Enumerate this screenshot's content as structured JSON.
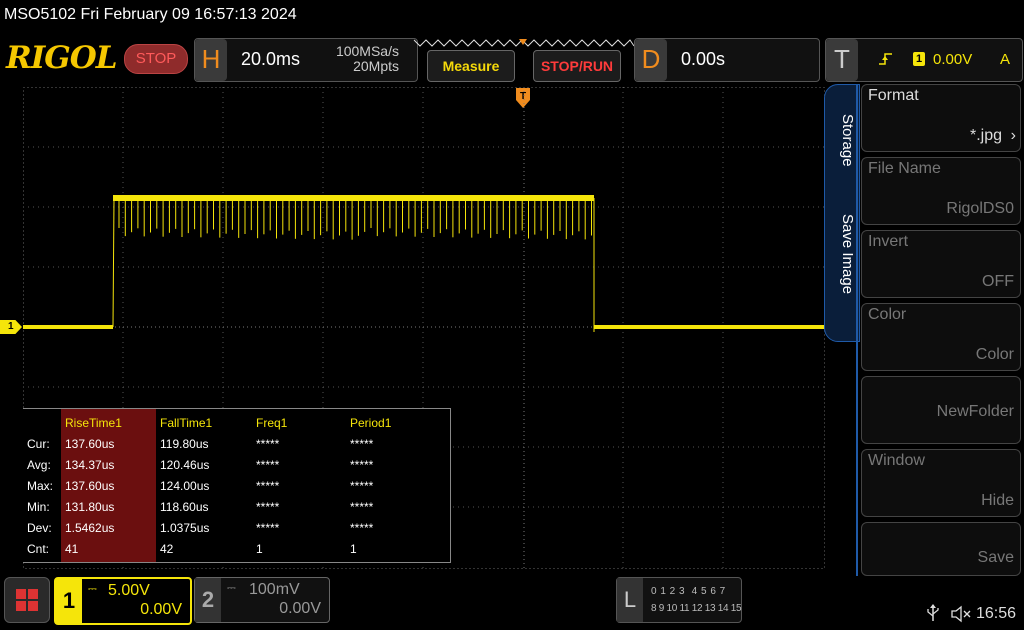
{
  "header": {
    "title": "MSO5102  Fri February 09 16:57:13 2024",
    "logo": "RIGOL",
    "stop_label": "STOP",
    "horizontal": {
      "letter": "H",
      "timebase": "20.0ms",
      "sample_rate": "100MSa/s",
      "memory_depth": "20Mpts"
    },
    "measure_label": "Measure",
    "stop_run_label": "STOP/RUN",
    "delay": {
      "letter": "D",
      "value": "0.00s"
    },
    "trigger": {
      "letter": "T",
      "source": "1",
      "level": "0.00V",
      "mode": "A"
    }
  },
  "channel_marker": "1",
  "measurements": {
    "row_labels": [
      "Cur:",
      "Avg:",
      "Max:",
      "Min:",
      "Dev:",
      "Cnt:"
    ],
    "columns": [
      {
        "name": "RiseTime1",
        "values": [
          "137.60us",
          "134.37us",
          "137.60us",
          "131.80us",
          "1.5462us",
          "41"
        ]
      },
      {
        "name": "FallTime1",
        "values": [
          "119.80us",
          "120.46us",
          "124.00us",
          "118.60us",
          "1.0375us",
          "42"
        ]
      },
      {
        "name": "Freq1",
        "values": [
          "*****",
          "*****",
          "*****",
          "*****",
          "*****",
          "1"
        ]
      },
      {
        "name": "Period1",
        "values": [
          "*****",
          "*****",
          "*****",
          "*****",
          "*****",
          "1"
        ]
      }
    ]
  },
  "side_tabs": [
    "Storage",
    "Save Image"
  ],
  "menu": [
    {
      "label": "Format",
      "value": "*.jpg",
      "enabled": true
    },
    {
      "label": "File Name",
      "value": "RigolDS0",
      "enabled": false
    },
    {
      "label": "Invert",
      "value": "OFF",
      "enabled": false
    },
    {
      "label": "Color",
      "value": "Color",
      "enabled": false
    },
    {
      "label": "",
      "value": "NewFolder",
      "enabled": false
    },
    {
      "label": "Window",
      "value": "Hide",
      "enabled": false
    },
    {
      "label": "",
      "value": "Save",
      "enabled": false
    }
  ],
  "channels": [
    {
      "num": "1",
      "scale": "5.00V",
      "offset": "0.00V",
      "active": true
    },
    {
      "num": "2",
      "scale": "100mV",
      "offset": "0.00V",
      "active": false
    }
  ],
  "logic": {
    "letter": "L",
    "row1": "0 1 2 3  4 5 6 7",
    "row2": "8 9 10 11 12 13 14 15"
  },
  "status": {
    "time": "16:56"
  },
  "colors": {
    "ch1": "#f5e50a",
    "accent": "#f5c700",
    "stop_red": "#ff5a5a",
    "orange": "#f08c1e"
  }
}
